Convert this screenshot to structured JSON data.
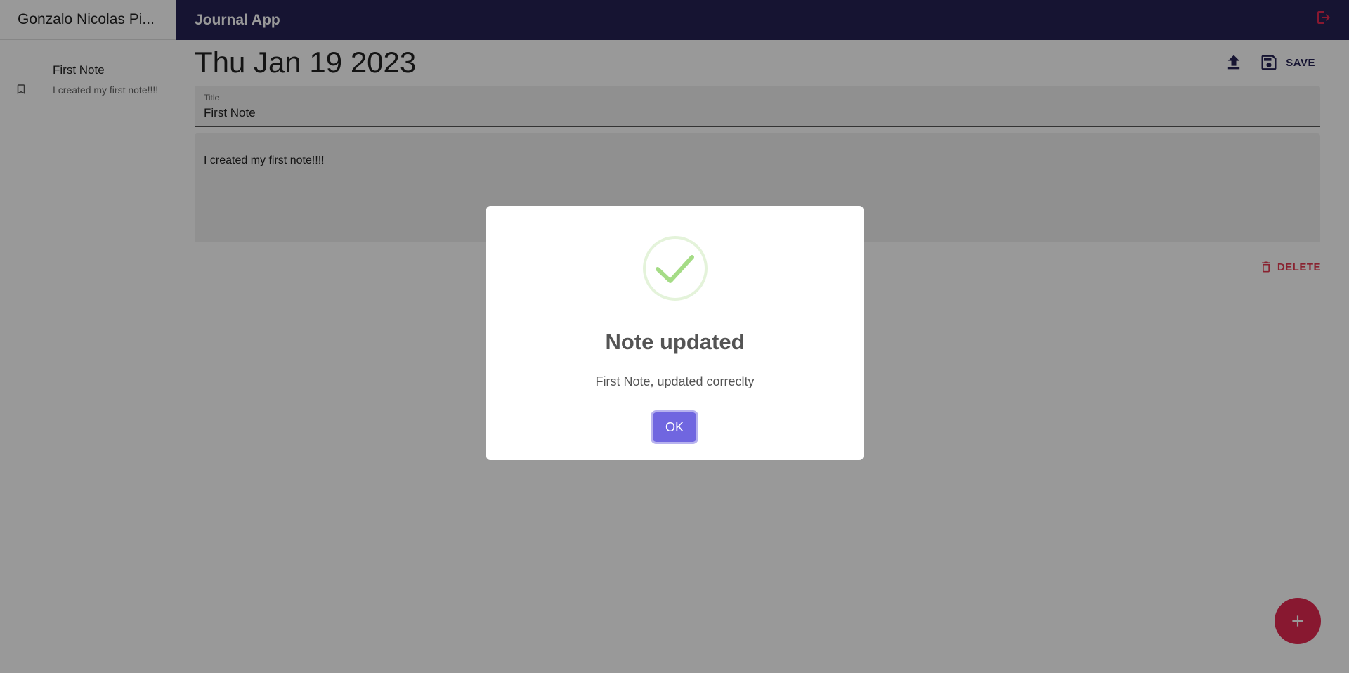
{
  "sidebar": {
    "user_name": "Gonzalo Nicolas Pi...",
    "notes": [
      {
        "title": "First Note",
        "snippet": "I created my first note!!!!",
        "icon": "bookmark-icon"
      }
    ]
  },
  "topbar": {
    "title": "Journal App",
    "logout_icon": "logout-icon"
  },
  "editor": {
    "date": "Thu Jan 19 2023",
    "save_label": "SAVE",
    "title_field": {
      "label": "Title",
      "value": "First Note"
    },
    "body_field": {
      "value": "I created my first note!!!!"
    },
    "delete_label": "DELETE"
  },
  "dialog": {
    "title": "Note updated",
    "text": "First Note, updated correclty",
    "ok_label": "OK",
    "icon": "checkmark-icon"
  },
  "colors": {
    "topbar": "#262254",
    "accent_red": "#e32951",
    "confirm_button": "#7066e0",
    "success_green": "#a5dc86"
  }
}
